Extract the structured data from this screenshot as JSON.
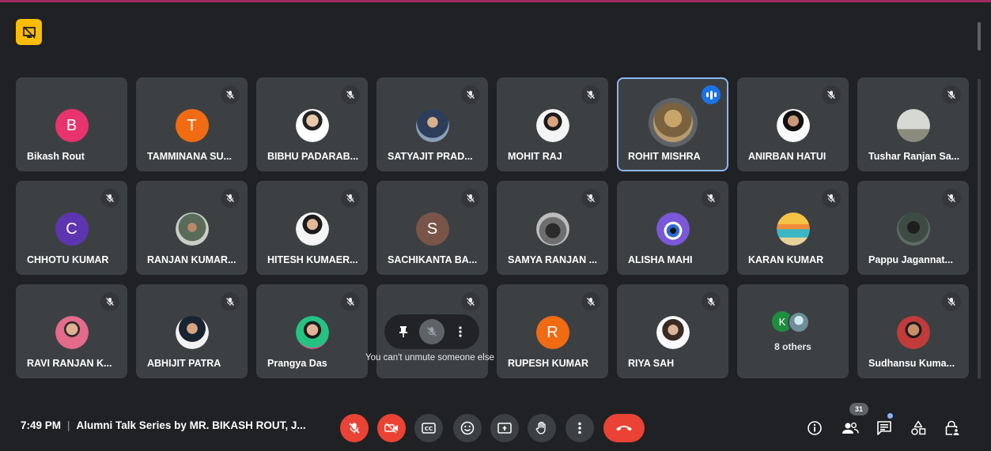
{
  "meeting": {
    "time": "7:49 PM",
    "separator": "|",
    "title": "Alumni Talk Series by MR. BIKASH ROUT, J...",
    "participant_count": "31"
  },
  "participants": [
    {
      "name": "Bikash Rout",
      "initial": "B",
      "color": "#e8336d"
    },
    {
      "name": "TAMMINANA SU...",
      "initial": "T",
      "color": "#f16b12"
    },
    {
      "name": "BIBHU PADARAB..."
    },
    {
      "name": "SATYAJIT PRAD..."
    },
    {
      "name": "MOHIT RAJ"
    },
    {
      "name": "ROHIT MISHRA"
    },
    {
      "name": "ANIRBAN HATUI"
    },
    {
      "name": "Tushar Ranjan Sa..."
    },
    {
      "name": "CHHOTU KUMAR",
      "initial": "C",
      "color": "#5e35b1"
    },
    {
      "name": "RANJAN KUMAR..."
    },
    {
      "name": "HITESH KUMAER..."
    },
    {
      "name": "SACHIKANTA BA...",
      "initial": "S",
      "color": "#795548"
    },
    {
      "name": "SAMYA RANJAN ..."
    },
    {
      "name": "ALISHA MAHI"
    },
    {
      "name": "KARAN KUMAR"
    },
    {
      "name": "Pappu Jagannat..."
    },
    {
      "name": "RAVI RANJAN K..."
    },
    {
      "name": "ABHIJIT PATRA"
    },
    {
      "name": "Prangya Das"
    },
    {
      "name": ""
    },
    {
      "name": "RUPESH KUMAR",
      "initial": "R",
      "color": "#f16b12"
    },
    {
      "name": "RIYA SAH"
    },
    {
      "name": "Sudhansu Kuma..."
    }
  ],
  "others_tile": {
    "label": "8 others",
    "initial": "K"
  },
  "tooltip": "You can't unmute someone else",
  "colors": {
    "accent": "#8ab4f8",
    "danger": "#ea4335",
    "tile": "#3c4043",
    "bg": "#202124",
    "badge": "#fbbc04"
  }
}
